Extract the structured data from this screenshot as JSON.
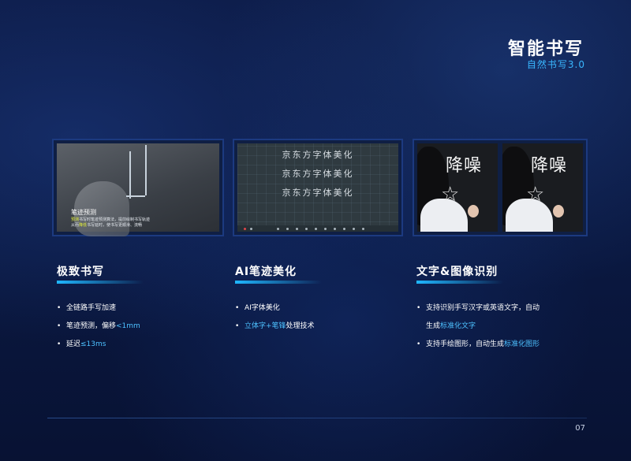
{
  "header": {
    "title": "智能书写",
    "subtitle": "自然书写3.0"
  },
  "thumbnails": {
    "thumb1": {
      "caption_title": "笔迹预测",
      "caption_line_pre": "",
      "caption_highlight_1": "预测",
      "caption_text_1": "书写时笔迹预测算法，提前绘制书写轨迹",
      "caption_text_2": "从而",
      "caption_highlight_2": "降低",
      "caption_text_3": "书写延时，使书写更顺滑、流畅"
    },
    "thumb2": {
      "lines": [
        "京东方字体美化",
        "京东方字体美化",
        "京东方字体美化"
      ]
    },
    "thumb3": {
      "chalk_text_a": "降噪",
      "chalk_text_b": "降噪"
    }
  },
  "sections": [
    {
      "title": "极致书写",
      "bullets": [
        {
          "text": "全链路手写加速"
        },
        {
          "pre": "笔迹预测，偏移",
          "highlight": "<1mm"
        },
        {
          "pre": "延迟",
          "highlight": "≤13ms"
        }
      ]
    },
    {
      "title": "AI笔迹美化",
      "bullets": [
        {
          "text": "AI字体美化"
        },
        {
          "highlight": "立体字+笔锋",
          "post": "处理技术"
        }
      ]
    },
    {
      "title": "文字&图像识别",
      "bullets": [
        {
          "line1": "支持识别手写汉字或英语文字，自动",
          "line2_pre": "生成",
          "line2_highlight": "标准化文字"
        },
        {
          "pre": "支持手绘图形，自动生成",
          "highlight": "标准化图形"
        }
      ]
    }
  ],
  "footer": {
    "page_number": "07"
  },
  "colors": {
    "accent": "#4dc1ff",
    "background": "#0a1840"
  }
}
